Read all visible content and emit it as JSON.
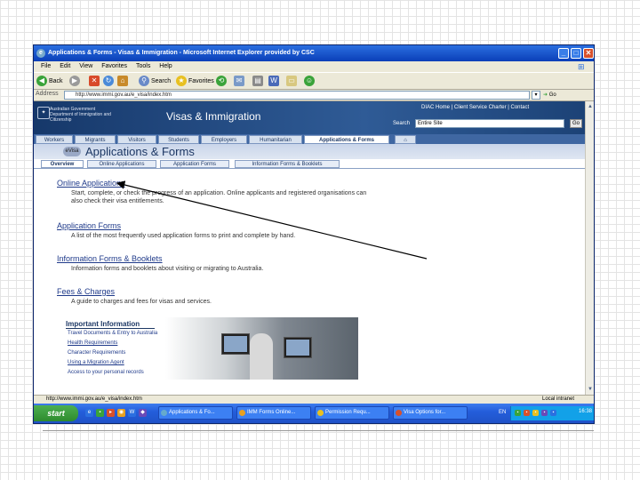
{
  "window": {
    "title": "Applications & Forms - Visas & Immigration - Microsoft Internet Explorer provided by CSC",
    "ie_icon": "e",
    "buttons": {
      "minimize": "_",
      "maximize": "□",
      "close": "✕"
    }
  },
  "menu": {
    "items": [
      "File",
      "Edit",
      "View",
      "Favorites",
      "Tools",
      "Help"
    ],
    "windows_logo": "⊞"
  },
  "toolbar": {
    "back_label": "Back",
    "search_label": "Search",
    "favorites_label": "Favorites"
  },
  "address": {
    "label": "Address",
    "url": "http://www.immi.gov.au/e_visa/index.htm",
    "dropdown": "▾",
    "go_label": "Go"
  },
  "site": {
    "crest": "✦",
    "gov_name": "Australian Government Department of Immigration and Citizenship",
    "title": "Visas & Immigration",
    "top_links": "DIAC Home | Client Service Charter | Contact",
    "search_label": "Search",
    "search_value": "Entire Site",
    "search_go": "Go",
    "nav_tabs": [
      "Workers",
      "Migrants",
      "Visitors",
      "Students",
      "Employers",
      "Humanitarian",
      "Applications & Forms",
      "⌂"
    ],
    "section_icon": "eVisa",
    "section_title": "Applications & Forms",
    "sub_tabs": [
      "Overview",
      "Online Applications",
      "Application Forms",
      "Information Forms & Booklets"
    ],
    "items": [
      {
        "title": "Online Applications",
        "desc": "Start, complete, or check the progress of an application. Online applicants and registered organisations can also check their visa entitlements."
      },
      {
        "title": "Application Forms",
        "desc": "A list of the most frequently used application forms to print and complete by hand."
      },
      {
        "title": "Information Forms & Booklets",
        "desc": "Information forms and booklets about visiting or migrating to Australia."
      },
      {
        "title": "Fees & Charges",
        "desc": "A guide to charges and fees for visas and services."
      }
    ],
    "important": {
      "title": "Important Information",
      "links": [
        "Travel Documents & Entry to Australia",
        "Health Requirements",
        "Character Requirements",
        "Using a Migration Agent",
        "Access to your personal records"
      ]
    }
  },
  "status": {
    "url": "http://www.immi.gov.au/e_visa/index.htm",
    "zone": "Local intranet"
  },
  "taskbar": {
    "start_label": "start",
    "tasks": [
      "Applications & Fo...",
      "IMM Forms Online...",
      "Permission Requ...",
      "Visa Options for..."
    ],
    "language": "EN",
    "clock": "16:38"
  }
}
